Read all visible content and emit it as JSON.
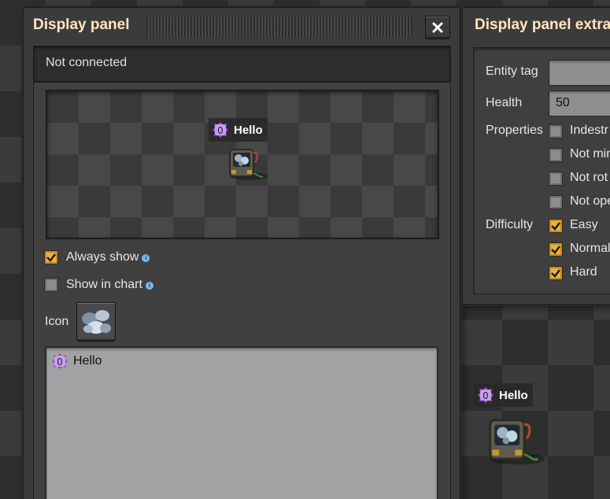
{
  "panel": {
    "title": "Display panel",
    "status": "Not connected",
    "preview_tag": {
      "signal": "0",
      "text": "Hello"
    },
    "always_show": {
      "label": "Always show",
      "checked": true
    },
    "show_in_chart": {
      "label": "Show in chart",
      "checked": false
    },
    "icon_label": "Icon",
    "text_area": {
      "signal": "0",
      "text": "Hello"
    }
  },
  "extras": {
    "title": "Display panel extra",
    "entity_tag_label": "Entity tag",
    "entity_tag_value": "",
    "health_label": "Health",
    "health_value": "50",
    "properties_label": "Properties",
    "properties": [
      {
        "label": "Indestr",
        "checked": false
      },
      {
        "label": "Not min",
        "checked": false
      },
      {
        "label": "Not rot",
        "checked": false
      },
      {
        "label": "Not ope",
        "checked": false
      }
    ],
    "difficulty_label": "Difficulty",
    "difficulty": [
      {
        "label": "Easy",
        "checked": true
      },
      {
        "label": "Normal",
        "checked": true
      },
      {
        "label": "Hard",
        "checked": true
      }
    ]
  },
  "world_tag": {
    "signal": "0",
    "text": "Hello"
  },
  "colors": {
    "title": "#ffe6c0",
    "checkbox_checked": "#f1b035",
    "signal_purple": "#9c4fd6"
  },
  "icons": [
    "close-icon",
    "info-icon",
    "signal-0-icon",
    "display-panel-entity-icon",
    "ore-icon",
    "checkmark-icon"
  ]
}
